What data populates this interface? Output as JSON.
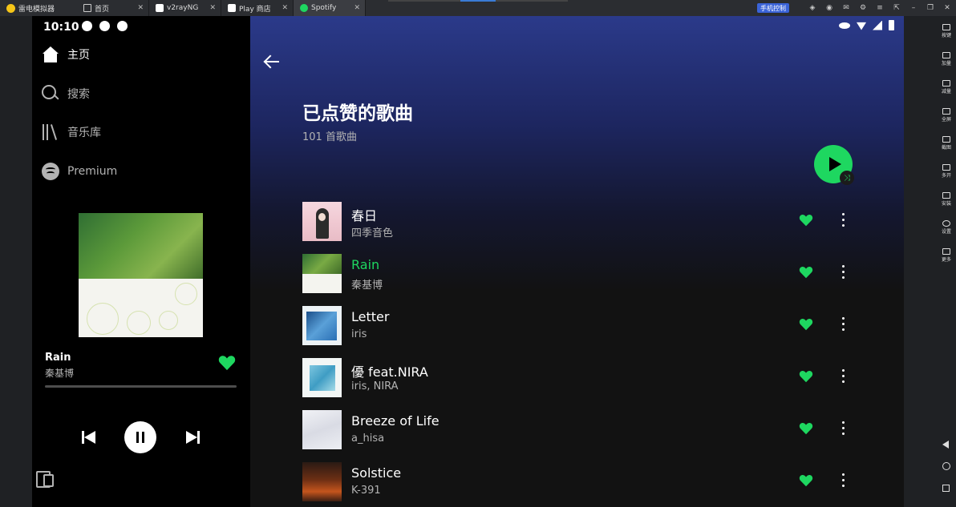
{
  "emulator": {
    "app_name": "雷电模拟器",
    "tabs": [
      {
        "label": "首页"
      },
      {
        "label": "v2rayNG"
      },
      {
        "label": "Play 商店"
      },
      {
        "label": "Spotify"
      }
    ],
    "phone_control_label": "手机控制",
    "right_sidebar": [
      {
        "label": "按键"
      },
      {
        "label": "加量"
      },
      {
        "label": "减量"
      },
      {
        "label": "全屏"
      },
      {
        "label": "截图"
      },
      {
        "label": "多开"
      },
      {
        "label": "安装"
      },
      {
        "label": "设置"
      },
      {
        "label": "更多"
      }
    ]
  },
  "status_bar": {
    "time": "10:10"
  },
  "sidebar": {
    "nav": [
      {
        "label": "主页",
        "icon": "home-icon"
      },
      {
        "label": "搜索",
        "icon": "search-icon"
      },
      {
        "label": "音乐库",
        "icon": "library-icon"
      },
      {
        "label": "Premium",
        "icon": "spotify-icon"
      }
    ],
    "now_playing": {
      "title": "Rain",
      "artist": "秦基博",
      "liked": true,
      "progress": 0
    }
  },
  "playlist": {
    "title": "已点赞的歌曲",
    "count": "101 首歌曲",
    "tracks": [
      {
        "title": "春日",
        "artist": "四季音色",
        "playing": false
      },
      {
        "title": "Rain",
        "artist": "秦基博",
        "playing": true
      },
      {
        "title": "Letter",
        "artist": "iris",
        "playing": false
      },
      {
        "title": "優 feat.NIRA",
        "artist": "iris, NIRA",
        "playing": false
      },
      {
        "title": "Breeze of Life",
        "artist": "a_hisa",
        "playing": false
      },
      {
        "title": "Solstice",
        "artist": "K-391",
        "playing": false
      }
    ]
  },
  "colors": {
    "accent": "#1ed760",
    "background": "#121212",
    "header_gradient_top": "#2b3a8a"
  }
}
